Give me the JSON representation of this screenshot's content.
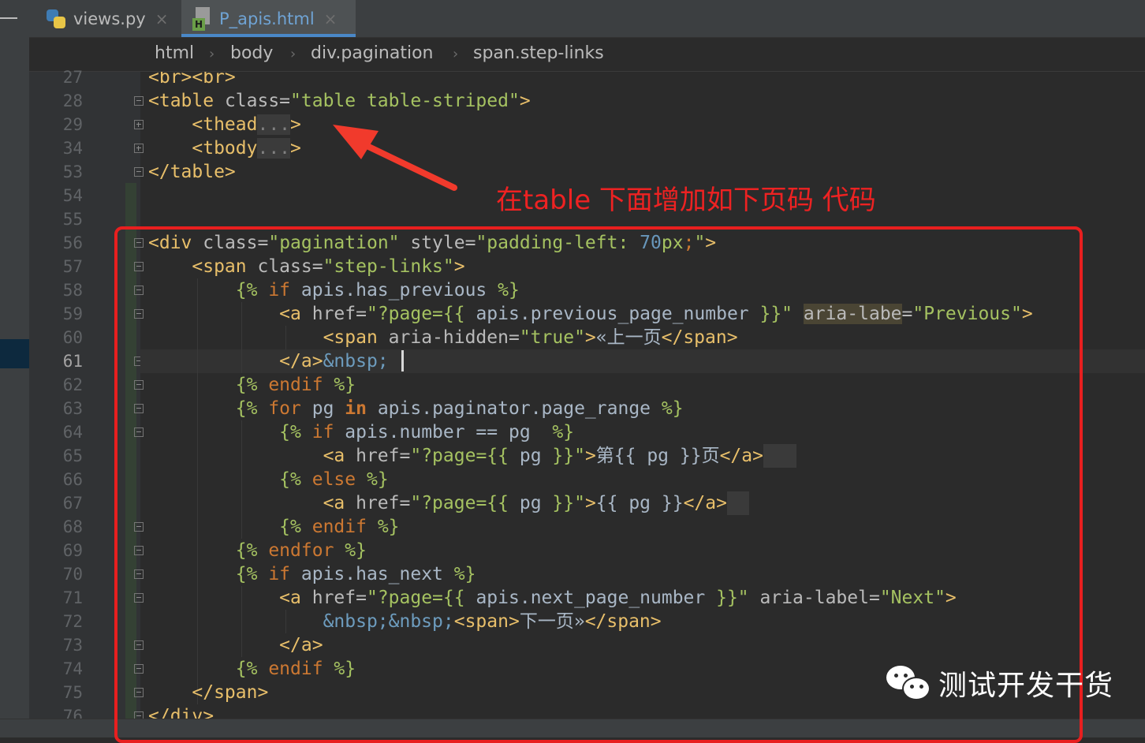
{
  "tabs": [
    {
      "label": "views.py",
      "icon": "python-file-icon",
      "active": false
    },
    {
      "label": "P_apis.html",
      "icon": "html-file-icon",
      "active": true
    }
  ],
  "tab_close_glyph": "×",
  "breadcrumb": [
    "html",
    "body",
    "div.pagination",
    "span.step-links"
  ],
  "breadcrumb_separator": "›",
  "current_line": "61",
  "lines": [
    {
      "num": "27",
      "text": "<br><br>"
    },
    {
      "num": "28",
      "text": "<table class=\"table table-striped\">"
    },
    {
      "num": "29",
      "text": "    <thead...>"
    },
    {
      "num": "34",
      "text": "    <tbody...>"
    },
    {
      "num": "53",
      "text": "</table>"
    },
    {
      "num": "54",
      "text": ""
    },
    {
      "num": "55",
      "text": ""
    },
    {
      "num": "56",
      "text": "<div class=\"pagination\" style=\"padding-left: 70px;\">"
    },
    {
      "num": "57",
      "text": "    <span class=\"step-links\">"
    },
    {
      "num": "58",
      "text": "        {% if apis.has_previous %}"
    },
    {
      "num": "59",
      "text": "            <a href=\"?page={{ apis.previous_page_number }}\" aria-labe=\"Previous\">"
    },
    {
      "num": "60",
      "text": "                <span aria-hidden=\"true\">«上一页</span>"
    },
    {
      "num": "61",
      "text": "            </a>&nbsp;"
    },
    {
      "num": "62",
      "text": "        {% endif %}"
    },
    {
      "num": "63",
      "text": "        {% for pg in apis.paginator.page_range %}"
    },
    {
      "num": "64",
      "text": "            {% if apis.number == pg  %}"
    },
    {
      "num": "65",
      "text": "                <a href=\"?page={{ pg }}\">第{{ pg }}页</a>"
    },
    {
      "num": "66",
      "text": "            {% else %}"
    },
    {
      "num": "67",
      "text": "                <a href=\"?page={{ pg }}\">{{ pg }}</a>"
    },
    {
      "num": "68",
      "text": "            {% endif %}"
    },
    {
      "num": "69",
      "text": "        {% endfor %}"
    },
    {
      "num": "70",
      "text": "        {% if apis.has_next %}"
    },
    {
      "num": "71",
      "text": "            <a href=\"?page={{ apis.next_page_number }}\" aria-label=\"Next\">"
    },
    {
      "num": "72",
      "text": "                &nbsp;&nbsp;<span>下一页»</span>"
    },
    {
      "num": "73",
      "text": "            </a>"
    },
    {
      "num": "74",
      "text": "        {% endif %}"
    },
    {
      "num": "75",
      "text": "    </span>"
    },
    {
      "num": "76",
      "text": "</div>"
    }
  ],
  "annotation": {
    "text": "在table 下面增加如下页码 代码",
    "color": "#ee2222"
  },
  "watermark": {
    "text": "测试开发干货",
    "icon": "wechat-icon"
  },
  "colors": {
    "tag": "#e8bf6a",
    "attr_value": "#a5c261",
    "keyword": "#cc7832",
    "number": "#6897bb",
    "annotation": "#e81f1f"
  }
}
